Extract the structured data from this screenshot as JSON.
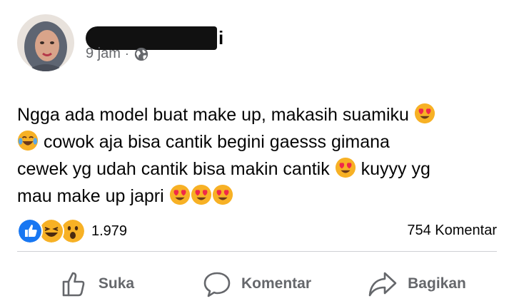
{
  "post": {
    "author_name_visible_suffix": "i",
    "time": "9 jam",
    "separator": "·",
    "privacy_icon": "globe-icon",
    "text_lines": [
      "Ngga ada model buat make up, makasih suamiku",
      "cowok aja bisa cantik begini gaesss gimana",
      "cewek yg udah cantik bisa makin cantik",
      "kuyyy yg",
      "mau make up japri"
    ]
  },
  "reactions": {
    "icons": [
      "like-icon",
      "haha-icon",
      "wow-icon"
    ],
    "count": "1.979",
    "comments": "754 Komentar"
  },
  "actions": {
    "like": "Suka",
    "comment": "Komentar",
    "share": "Bagikan"
  },
  "colors": {
    "like_blue": "#1877f2",
    "meta_gray": "#65676b",
    "emoji_yellow": "#f7b125",
    "heart_red": "#f02849"
  }
}
